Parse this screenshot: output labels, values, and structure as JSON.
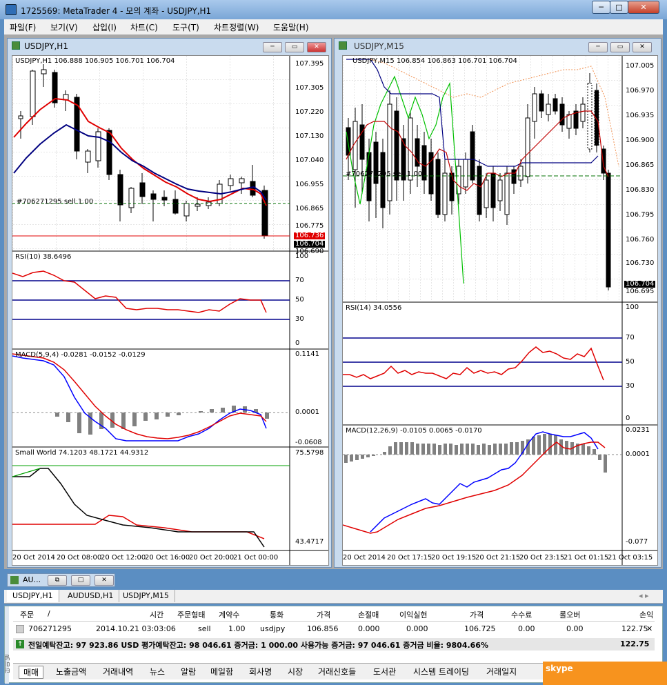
{
  "window": {
    "title": "1725569: MetaTrader 4 - 모의 계좌 - USDJPY,H1",
    "min": "─",
    "max": "□",
    "close": "✕"
  },
  "menu": [
    "파일(F)",
    "보기(V)",
    "삽입(I)",
    "차트(C)",
    "도구(T)",
    "차트정렬(W)",
    "도움말(H)"
  ],
  "left": {
    "title": "USDJPY,H1",
    "header": "USDJPY,H1  106.888 106.905 106.701 106.704",
    "price_ticks": [
      "107.395",
      "107.305",
      "107.220",
      "107.130",
      "107.040",
      "106.955",
      "106.865",
      "106.775",
      "106.736",
      "106.704",
      "106.690"
    ],
    "order_label": "#706271295 sell 1.00",
    "rsi_label": "RSI(10) 38.6496",
    "rsi_ticks": [
      "100",
      "70",
      "50",
      "30",
      "0"
    ],
    "macd_label": "MACD(5,9,4) -0.0281 -0.0152 -0.0129",
    "macd_ticks": [
      "0.1141",
      "0.0001",
      "-0.0608"
    ],
    "sw_label": "Small World 74.1203 48.1721 44.9312",
    "sw_ticks": [
      "75.5798",
      "43.4717"
    ],
    "time_ticks": [
      "20 Oct 2014",
      "20 Oct 08:00",
      "20 Oct 12:00",
      "20 Oct 16:00",
      "20 Oct 20:00",
      "21 Oct 00:00"
    ]
  },
  "right": {
    "title": "USDJPY,M15",
    "header": "USDJPY,M15  106.854 106.863 106.701 106.704",
    "price_ticks": [
      "107.005",
      "106.970",
      "106.935",
      "106.900",
      "106.865",
      "106.830",
      "106.795",
      "106.760",
      "106.730",
      "106.704",
      "106.695"
    ],
    "order_label": "#706271295 sell 1.00",
    "rsi_label": "RSI(14) 34.0556",
    "rsi_ticks": [
      "100",
      "70",
      "50",
      "30",
      "0"
    ],
    "macd_label": "MACD(12,26,9) -0.0105 0.0065 -0.0170",
    "macd_ticks": [
      "0.0231",
      "0.0001",
      "-0.077"
    ],
    "time_ticks": [
      "20 Oct 2014",
      "20 Oct 17:15",
      "20 Oct 19:15",
      "20 Oct 21:15",
      "20 Oct 23:15",
      "21 Oct 01:15",
      "21 Oct 03:15"
    ]
  },
  "minimized": {
    "title": "AU..."
  },
  "chart_tabs": [
    "USDJPY,H1",
    "AUDUSD,H1",
    "USDJPY,M15"
  ],
  "terminal": {
    "headers": [
      "주문",
      "/",
      "시간",
      "주문형태",
      "계약수",
      "통화",
      "가격",
      "손절매",
      "이익실현",
      "가격",
      "수수료",
      "롤오버",
      "손익"
    ],
    "row": [
      "706271295",
      "2014.10.21 03:03:06",
      "sell",
      "1.00",
      "usdjpy",
      "106.856",
      "0.000",
      "0.000",
      "106.725",
      "0.00",
      "0.00",
      "122.75"
    ],
    "summary": "전일예탁잔고: 97 923.86 USD   평가예탁잔고: 98 046.61   증거금: 1 000.00   사용가능 증거금: 97 046.61   증거금 비율: 9804.66%",
    "summary_total": "122.75",
    "side_label": "터미널",
    "bottom_tabs": [
      "매매",
      "노출금액",
      "거래내역",
      "뉴스",
      "알람",
      "메일함",
      "회사명",
      "시장",
      "거래신호들",
      "도서관",
      "시스템 트레이딩",
      "거래일지"
    ],
    "skype": "skype"
  },
  "colors": {
    "bull": "#ffffff",
    "bear": "#000000",
    "ma_red": "#e00000",
    "ma_blue": "#000080",
    "level": "#00008b",
    "green": "#00c000"
  }
}
